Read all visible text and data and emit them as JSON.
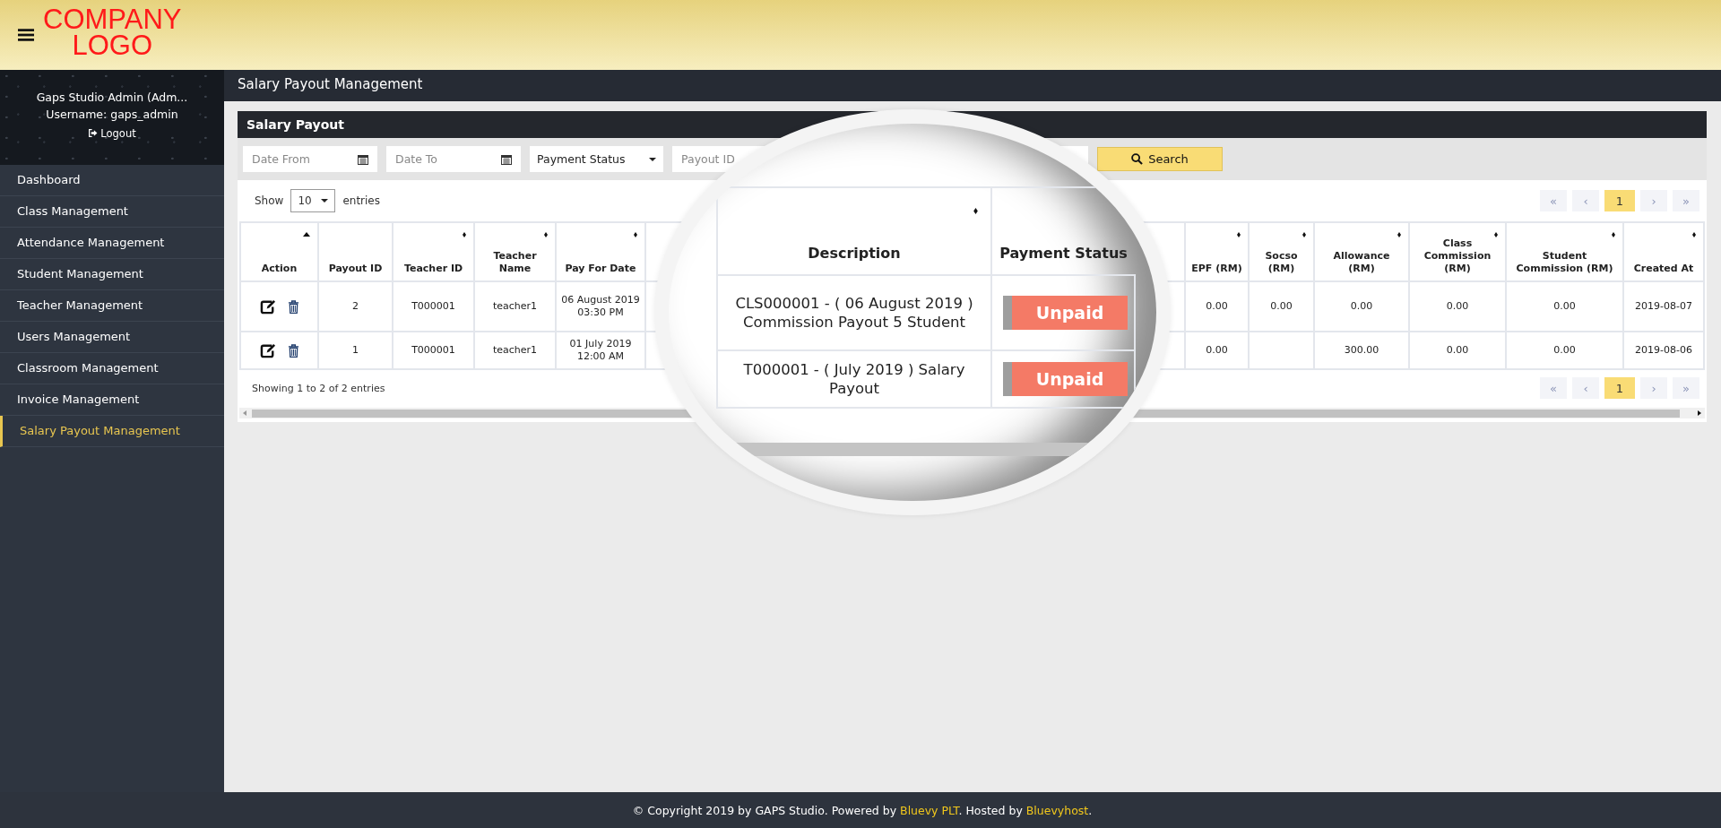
{
  "logo": {
    "lines": [
      "COMPANY",
      "LOGO"
    ]
  },
  "sidebar": {
    "user": {
      "name": "Gaps Studio Admin (Adm...",
      "username": "Username: gaps_admin",
      "logout": "Logout"
    },
    "items": [
      {
        "label": "Dashboard",
        "selected": false
      },
      {
        "label": "Class Management",
        "selected": false
      },
      {
        "label": "Attendance Management",
        "selected": false
      },
      {
        "label": "Student Management",
        "selected": false
      },
      {
        "label": "Teacher Management",
        "selected": false
      },
      {
        "label": "Users Management",
        "selected": false
      },
      {
        "label": "Classroom Management",
        "selected": false
      },
      {
        "label": "Invoice Management",
        "selected": false
      },
      {
        "label": "Salary Payout Management",
        "selected": true
      }
    ]
  },
  "page_title": "Salary Payout Management",
  "panel": {
    "title": "Salary Payout",
    "filters": [
      {
        "kind": "date",
        "placeholder": "Date From"
      },
      {
        "kind": "date",
        "placeholder": "Date To"
      },
      {
        "kind": "select",
        "value": "Payment Status"
      },
      {
        "kind": "text",
        "placeholder": "Payout ID"
      }
    ],
    "search_button": "Search"
  },
  "table": {
    "length": {
      "before": "Show",
      "value": "10",
      "after": "entries"
    },
    "pagination_top": [
      {
        "label": "«",
        "selected": false,
        "disabled": true
      },
      {
        "label": "‹",
        "selected": false,
        "disabled": true
      },
      {
        "label": "1",
        "selected": true,
        "disabled": false
      },
      {
        "label": "›",
        "selected": false,
        "disabled": true
      },
      {
        "label": "»",
        "selected": false,
        "disabled": true
      }
    ],
    "columns": [
      {
        "label": "Action",
        "sortable": true,
        "sorted": true
      },
      {
        "label": "Payout ID",
        "sortable": false
      },
      {
        "label": "Teacher ID",
        "sortable": true,
        "sorted": false
      },
      {
        "label": "Teacher Name",
        "sortable": true,
        "sorted": false
      },
      {
        "label": "Pay For Date",
        "sortable": true,
        "sorted": false
      },
      {
        "label": "EPF (RM)",
        "sortable": true,
        "sorted": false
      },
      {
        "label": "Socso (RM)",
        "sortable": true,
        "sorted": false
      },
      {
        "label": "Allowance (RM)",
        "sortable": true,
        "sorted": false
      },
      {
        "label": "Class Commission (RM)",
        "sortable": true,
        "sorted": false
      },
      {
        "label": "Student Commission (RM)",
        "sortable": true,
        "sorted": false
      },
      {
        "label": "Created At",
        "sortable": true,
        "sorted": false
      }
    ],
    "rows": [
      {
        "cells": [
          "",
          "2",
          "T000001",
          "teacher1",
          "06 August 2019 03:30 PM",
          "0.00",
          "0.00",
          "0.00",
          "0.00",
          "0.00",
          "2019-08-07"
        ]
      },
      {
        "cells": [
          "",
          "1",
          "T000001",
          "teacher1",
          "01 July 2019 12:00 AM",
          "0.00",
          "",
          "300.00",
          "0.00",
          "0.00",
          "2019-08-06"
        ]
      }
    ],
    "info": "Showing 1 to 2 of 2 entries",
    "pagination_bottom": [
      {
        "label": "«",
        "selected": false,
        "disabled": true
      },
      {
        "label": "‹",
        "selected": false,
        "disabled": true
      },
      {
        "label": "1",
        "selected": true,
        "disabled": false
      },
      {
        "label": "›",
        "selected": false,
        "disabled": true
      },
      {
        "label": "»",
        "selected": false,
        "disabled": true
      }
    ]
  },
  "magnifier": {
    "columns": [
      {
        "label": "Description",
        "sortable": true
      },
      {
        "label": "Payment Status"
      }
    ],
    "rows": [
      {
        "description": "CLS000001 - ( 06 August 2019 ) Commission Payout 5 Student",
        "status": "Unpaid",
        "paid": false
      },
      {
        "description": "T000001 - ( July 2019 ) Salary Payout",
        "status": "Unpaid",
        "paid": false
      }
    ]
  },
  "footer": {
    "parts": [
      {
        "kind": "text",
        "text": "© Copyright 2019 by GAPS Studio. Powered by "
      },
      {
        "kind": "link",
        "text": "Bluevy PLT"
      },
      {
        "kind": "text",
        "text": ". Hosted by "
      },
      {
        "kind": "link",
        "text": "Bluevyhost"
      },
      {
        "kind": "text",
        "text": "."
      }
    ]
  }
}
